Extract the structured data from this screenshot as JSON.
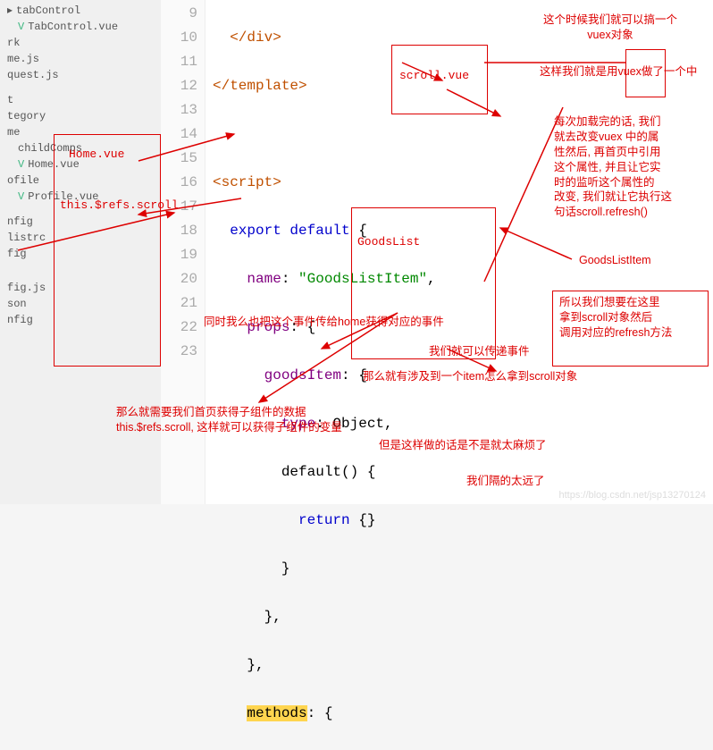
{
  "sidebar": {
    "items": [
      {
        "label": "tabControl",
        "icon": "folder"
      },
      {
        "label": "TabControl.vue",
        "icon": "vue",
        "indent": 1
      },
      {
        "label": "rk",
        "icon": "folder"
      },
      {
        "label": "me.js",
        "icon": "file"
      },
      {
        "label": "quest.js",
        "icon": "file"
      },
      {
        "label": "t",
        "icon": "folder"
      },
      {
        "label": "tegory",
        "icon": "folder"
      },
      {
        "label": "me",
        "icon": "folder"
      },
      {
        "label": "childComps",
        "icon": "folder",
        "indent": 1
      },
      {
        "label": "Home.vue",
        "icon": "vue",
        "indent": 1
      },
      {
        "label": "ofile",
        "icon": "folder"
      },
      {
        "label": "Profile.vue",
        "icon": "vue",
        "indent": 1
      },
      {
        "label": "nfig",
        "icon": "file"
      },
      {
        "label": "listrc",
        "icon": "file"
      },
      {
        "label": "fig",
        "icon": "file"
      },
      {
        "label": "fig.js",
        "icon": "file"
      },
      {
        "label": "son",
        "icon": "file"
      },
      {
        "label": "nfig",
        "icon": "file"
      }
    ]
  },
  "gutter": {
    "lines": [
      "9",
      "10",
      "11",
      "12",
      "13",
      "14",
      "15",
      "16",
      "17",
      "18",
      "19",
      "20",
      "21",
      "22",
      "23"
    ]
  },
  "code": {
    "l9": "  </div>",
    "l10": "</template>",
    "l12": "<script>",
    "l13a": "  export default ",
    "l13b": "{",
    "l14a": "    name",
    "l14b": ": ",
    "l14c": "\"GoodsListItem\"",
    "l14d": ",",
    "l15a": "    props",
    "l15b": ": {",
    "l16a": "      goodsItem",
    "l16b": ": {",
    "l17a": "        type",
    "l17b": ": Object,",
    "l18a": "        default",
    "l18b": "() {",
    "l19a": "          return ",
    "l19b": "{}",
    "l20": "        }",
    "l21": "      },",
    "l22": "    },",
    "l23a": "    ",
    "l23b": "methods",
    "l23c": ": {"
  },
  "ann": {
    "home": "Home.vue",
    "refs": "this.$refs.scroll",
    "scrollvue": "scroll.vue",
    "goodslist": "GoodsList",
    "gli": "GoodsListItem",
    "top1": "这个时候我们就可以搞一个\nvuex对象",
    "top2": "这样我们就是用vuex做了一个中",
    "para": "每次加载完的话, 我们\n就去改变vuex 中的属\n性然后, 再首页中引用\n这个属性, 并且让它实\n时的监听这个属性的\n改变, 我们就让它执行这\n句话scroll.refresh()",
    "mid1": "同时我么也把这个事件传给home获得对应的事件",
    "mid2": "我们就可以传递事件",
    "right1": "所以我们想要在这里\n拿到scroll对象然后\n调用对应的refresh方法",
    "q": "那么就有涉及到一个item怎么拿到scroll对象",
    "bot1": "那么就需要我们首页获得子组件的数据\nthis.$refs.scroll, 这样就可以获得子组件的变量",
    "bot2": "但是这样做的话是不是就太麻烦了",
    "bot3": "我们隔的太远了",
    "wm": "https://blog.csdn.net/jsp13270124"
  }
}
